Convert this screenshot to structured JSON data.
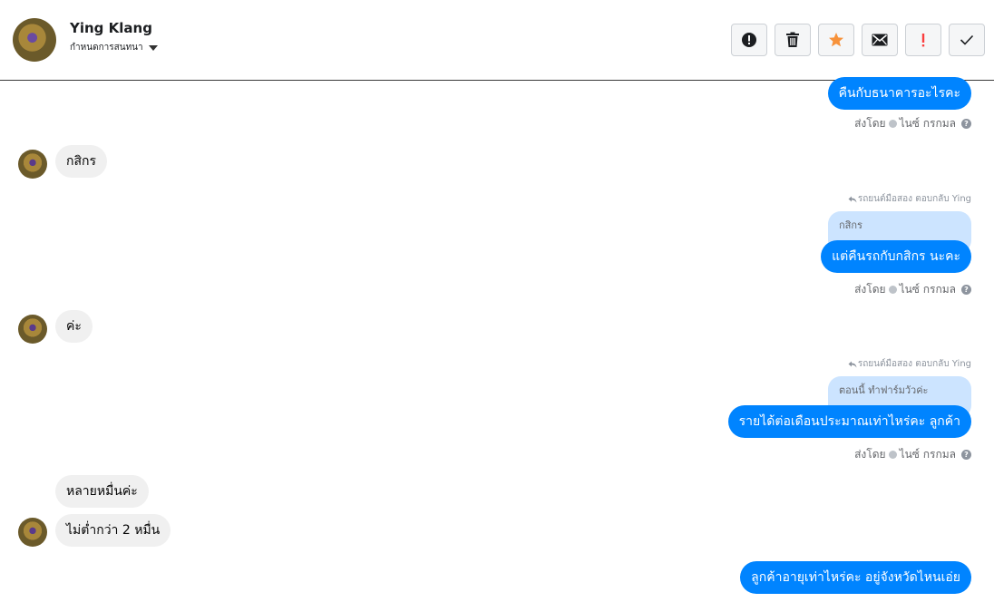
{
  "header": {
    "name": "Ying Klang",
    "subtitle": "กำหนดการสนทนา"
  },
  "toolbar": {
    "buttons": [
      {
        "icon": "alert-circle-icon"
      },
      {
        "icon": "trash-icon"
      },
      {
        "icon": "star-icon",
        "color": "#f7923a"
      },
      {
        "icon": "envelope-icon"
      },
      {
        "icon": "exclamation-icon",
        "color": "#fa3e3e"
      },
      {
        "icon": "checkmark-icon"
      }
    ]
  },
  "messages": {
    "m1_out": "คืนกับธนาคารอะไรคะ",
    "m1_status": "ส่งโดย",
    "m1_sender": "ไนซ์ กรกมล",
    "m2_in": "กสิกร",
    "m3_reply_note": "รถยนต์มือสอง ตอบกลับ Ying",
    "m3_quote": "กสิกร",
    "m3_out": "แต่คืนรถกับกสิกร นะคะ",
    "m3_status": "ส่งโดย",
    "m3_sender": "ไนซ์ กรกมล",
    "m4_in": "ค่ะ",
    "m5_reply_note": "รถยนต์มือสอง ตอบกลับ Ying",
    "m5_quote": "ตอนนี้ ทำฟาร์มวัวค่ะ",
    "m5_out": "รายได้ต่อเดือนประมาณเท่าไหร่คะ ลูกค้า",
    "m5_status": "ส่งโดย",
    "m5_sender": "ไนซ์ กรกมล",
    "m6_in": "หลายหมื่นค่ะ",
    "m7_in": "ไม่ต่ำกว่า 2 หมื่น",
    "m8_out": "ลูกค้าอายุเท่าไหร่คะ อยู่จังหวัดไหนเอ่ย"
  }
}
